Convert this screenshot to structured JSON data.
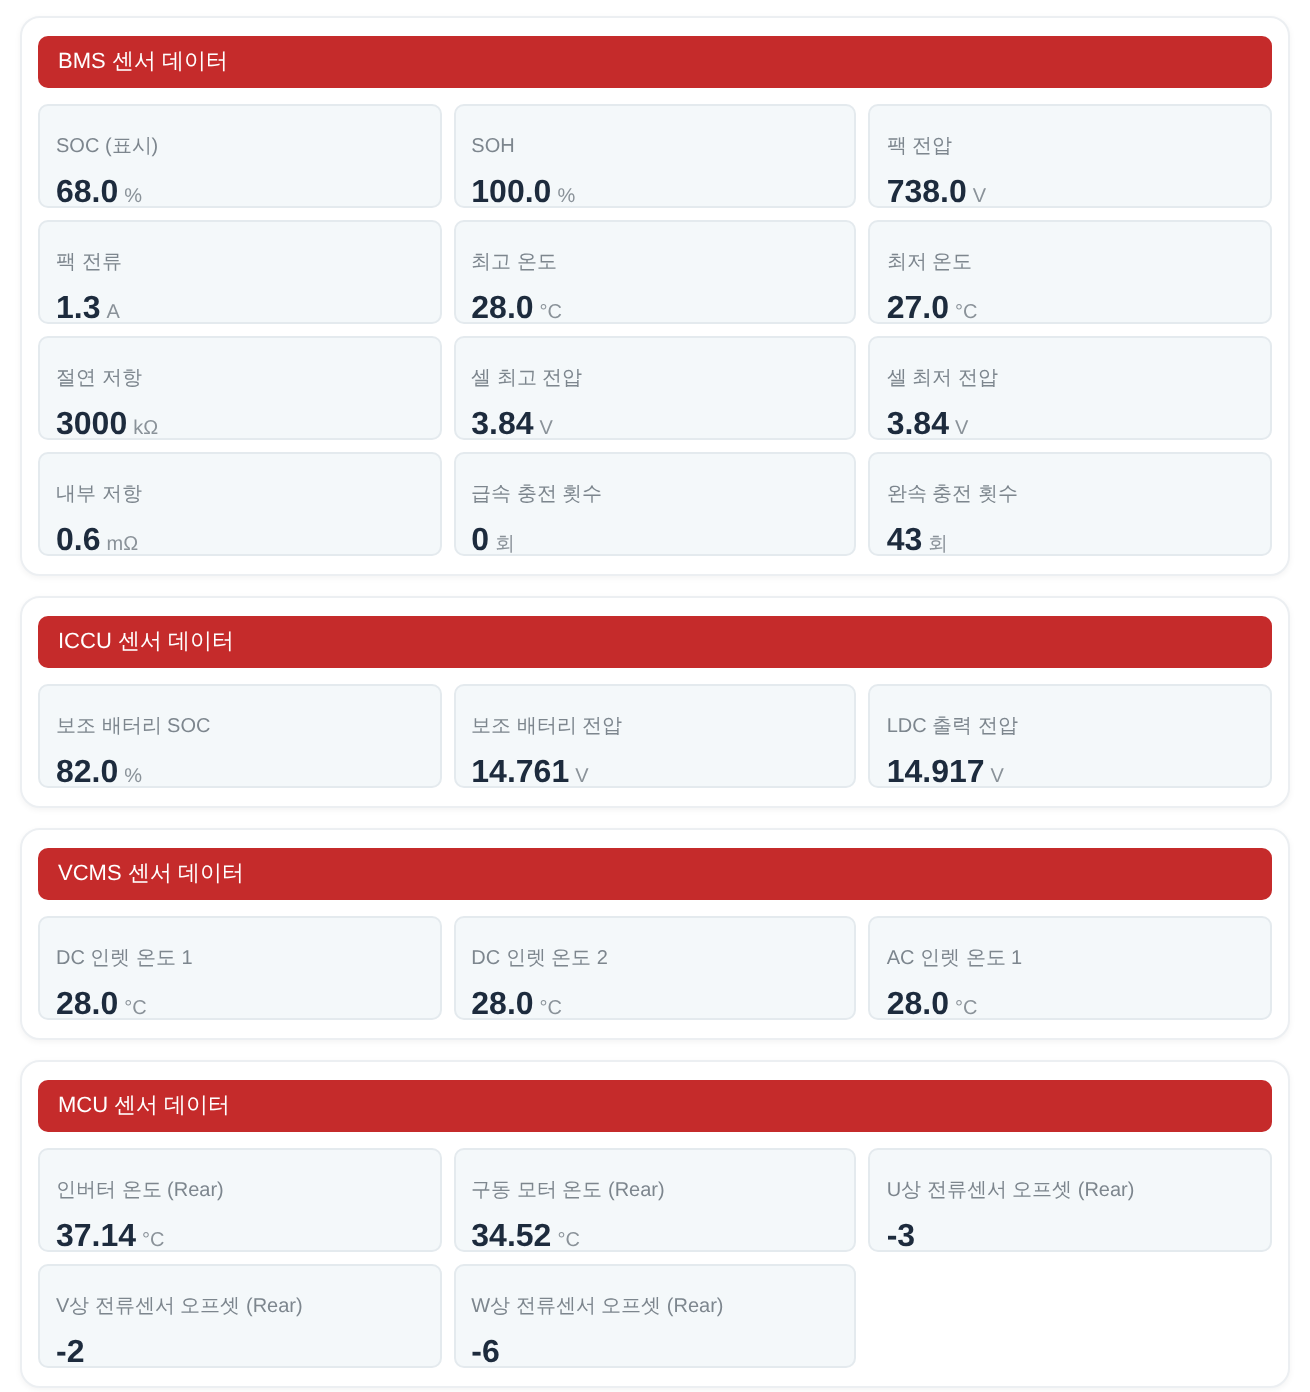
{
  "sections": [
    {
      "title": "BMS 센서 데이터",
      "items": [
        {
          "label": "SOC (표시)",
          "value": "68.0",
          "unit": "%"
        },
        {
          "label": "SOH",
          "value": "100.0",
          "unit": "%"
        },
        {
          "label": "팩 전압",
          "value": "738.0",
          "unit": "V"
        },
        {
          "label": "팩 전류",
          "value": "1.3",
          "unit": "A"
        },
        {
          "label": "최고 온도",
          "value": "28.0",
          "unit": "°C"
        },
        {
          "label": "최저 온도",
          "value": "27.0",
          "unit": "°C"
        },
        {
          "label": "절연 저항",
          "value": "3000",
          "unit": "kΩ"
        },
        {
          "label": "셀 최고 전압",
          "value": "3.84",
          "unit": "V"
        },
        {
          "label": "셀 최저 전압",
          "value": "3.84",
          "unit": "V"
        },
        {
          "label": "내부 저항",
          "value": "0.6",
          "unit": "mΩ"
        },
        {
          "label": "급속 충전 횟수",
          "value": "0",
          "unit": "회"
        },
        {
          "label": "완속 충전 횟수",
          "value": "43",
          "unit": "회"
        }
      ]
    },
    {
      "title": "ICCU 센서 데이터",
      "items": [
        {
          "label": "보조 배터리 SOC",
          "value": "82.0",
          "unit": "%"
        },
        {
          "label": "보조 배터리 전압",
          "value": "14.761",
          "unit": "V"
        },
        {
          "label": "LDC 출력 전압",
          "value": "14.917",
          "unit": "V"
        }
      ]
    },
    {
      "title": "VCMS 센서 데이터",
      "items": [
        {
          "label": "DC 인렛 온도 1",
          "value": "28.0",
          "unit": "°C"
        },
        {
          "label": "DC 인렛 온도 2",
          "value": "28.0",
          "unit": "°C"
        },
        {
          "label": "AC 인렛 온도 1",
          "value": "28.0",
          "unit": "°C"
        }
      ]
    },
    {
      "title": "MCU 센서 데이터",
      "items": [
        {
          "label": "인버터 온도 (Rear)",
          "value": "37.14",
          "unit": "°C"
        },
        {
          "label": "구동 모터 온도 (Rear)",
          "value": "34.52",
          "unit": "°C"
        },
        {
          "label": "U상 전류센서 오프셋 (Rear)",
          "value": "-3"
        },
        {
          "label": "V상 전류센서 오프셋 (Rear)",
          "value": "-2"
        },
        {
          "label": "W상 전류센서 오프셋 (Rear)",
          "value": "-6"
        }
      ]
    }
  ]
}
